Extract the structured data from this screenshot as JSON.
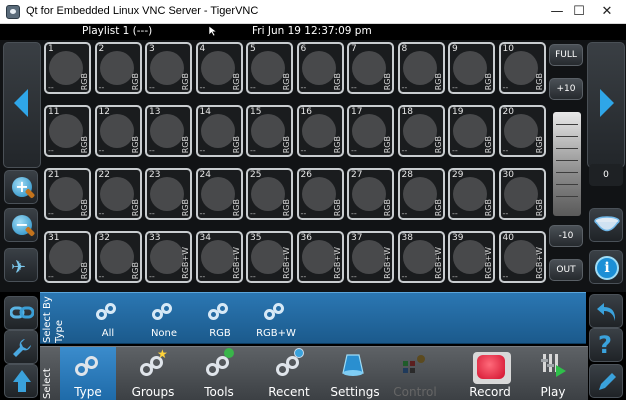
{
  "window": {
    "title": "Qt for Embedded Linux VNC Server - TigerVNC",
    "minimize_glyph": "—",
    "maximize_glyph": "☐",
    "close_glyph": "✕"
  },
  "topbar": {
    "playlist": "Playlist 1 (---)",
    "datetime": "Fri Jun 19 12:37:09 pm"
  },
  "grid": {
    "cells": [
      {
        "num": "1",
        "dash": "--",
        "mode": "RGB"
      },
      {
        "num": "2",
        "dash": "--",
        "mode": "RGB"
      },
      {
        "num": "3",
        "dash": "--",
        "mode": "RGB"
      },
      {
        "num": "4",
        "dash": "--",
        "mode": "RGB"
      },
      {
        "num": "5",
        "dash": "--",
        "mode": "RGB"
      },
      {
        "num": "6",
        "dash": "--",
        "mode": "RGB"
      },
      {
        "num": "7",
        "dash": "--",
        "mode": "RGB"
      },
      {
        "num": "8",
        "dash": "--",
        "mode": "RGB"
      },
      {
        "num": "9",
        "dash": "--",
        "mode": "RGB"
      },
      {
        "num": "10",
        "dash": "--",
        "mode": "RGB"
      },
      {
        "num": "11",
        "dash": "--",
        "mode": "RGB"
      },
      {
        "num": "12",
        "dash": "--",
        "mode": "RGB"
      },
      {
        "num": "13",
        "dash": "--",
        "mode": "RGB"
      },
      {
        "num": "14",
        "dash": "--",
        "mode": "RGB"
      },
      {
        "num": "15",
        "dash": "--",
        "mode": "RGB"
      },
      {
        "num": "16",
        "dash": "--",
        "mode": "RGB"
      },
      {
        "num": "17",
        "dash": "--",
        "mode": "RGB"
      },
      {
        "num": "18",
        "dash": "--",
        "mode": "RGB"
      },
      {
        "num": "19",
        "dash": "--",
        "mode": "RGB"
      },
      {
        "num": "20",
        "dash": "--",
        "mode": "RGB"
      },
      {
        "num": "21",
        "dash": "--",
        "mode": "RGB"
      },
      {
        "num": "22",
        "dash": "--",
        "mode": "RGB"
      },
      {
        "num": "23",
        "dash": "--",
        "mode": "RGB"
      },
      {
        "num": "24",
        "dash": "--",
        "mode": "RGB"
      },
      {
        "num": "25",
        "dash": "--",
        "mode": "RGB"
      },
      {
        "num": "26",
        "dash": "--",
        "mode": "RGB"
      },
      {
        "num": "27",
        "dash": "--",
        "mode": "RGB"
      },
      {
        "num": "28",
        "dash": "--",
        "mode": "RGB"
      },
      {
        "num": "29",
        "dash": "--",
        "mode": "RGB"
      },
      {
        "num": "30",
        "dash": "--",
        "mode": "RGB"
      },
      {
        "num": "31",
        "dash": "--",
        "mode": "RGB"
      },
      {
        "num": "32",
        "dash": "--",
        "mode": "RGB"
      },
      {
        "num": "33",
        "dash": "--",
        "mode": "RGB+W"
      },
      {
        "num": "34",
        "dash": "--",
        "mode": "RGB+W"
      },
      {
        "num": "35",
        "dash": "--",
        "mode": "RGB+W"
      },
      {
        "num": "36",
        "dash": "--",
        "mode": "RGB+W"
      },
      {
        "num": "37",
        "dash": "--",
        "mode": "RGB+W"
      },
      {
        "num": "38",
        "dash": "--",
        "mode": "RGB+W"
      },
      {
        "num": "39",
        "dash": "--",
        "mode": "RGB+W"
      },
      {
        "num": "40",
        "dash": "--",
        "mode": "RGB+W"
      }
    ]
  },
  "master": {
    "full_label": "FULL",
    "plus10_label": "+10",
    "minus10_label": "-10",
    "out_label": "OUT",
    "level_value": "0"
  },
  "typestrip": {
    "label": "Select By Type",
    "items": [
      {
        "label": "All"
      },
      {
        "label": "None"
      },
      {
        "label": "RGB"
      },
      {
        "label": "RGB+W"
      }
    ]
  },
  "bottombar": {
    "label": "Select",
    "items": [
      {
        "label": "Type"
      },
      {
        "label": "Groups"
      },
      {
        "label": "Tools"
      },
      {
        "label": "Recent"
      },
      {
        "label": "Settings"
      },
      {
        "label": "Control"
      },
      {
        "label": "Record"
      },
      {
        "label": "Play"
      }
    ]
  },
  "colors": {
    "accent_blue": "#2b77b3",
    "record_red": "#d10f2c",
    "nav_arrow": "#2fa6e8"
  }
}
